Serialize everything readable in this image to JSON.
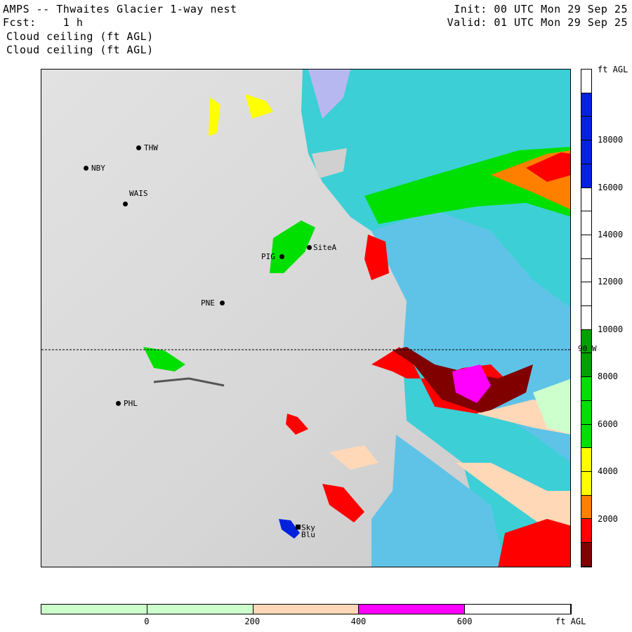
{
  "header": {
    "title": "AMPS -- Thwaites Glacier 1-way nest",
    "forecast": "Fcst:    1 h",
    "field_1": "Cloud ceiling (ft AGL)",
    "field_2": "Cloud ceiling (ft AGL)",
    "init": "Init: 00 UTC Mon 29 Sep 25",
    "valid": "Valid: 01 UTC Mon 29 Sep 25"
  },
  "map": {
    "meridian_label": "90 W",
    "stations": [
      {
        "name": "THW"
      },
      {
        "name": "NBY"
      },
      {
        "name": "WAIS"
      },
      {
        "name": "PIG"
      },
      {
        "name": "SiteA"
      },
      {
        "name": "PNE"
      },
      {
        "name": "PHL"
      },
      {
        "name": "Sky"
      },
      {
        "name": "Blu"
      }
    ]
  },
  "colorbar": {
    "units": "ft AGL",
    "labels": [
      "18000",
      "16000",
      "14000",
      "12000",
      "10000",
      "8000",
      "6000",
      "4000",
      "2000"
    ],
    "colors": [
      "#ffffff",
      "#0022dd",
      "#0022dd",
      "#0022dd",
      "#0022dd",
      "#ffffff",
      "#ffffff",
      "#ffffff",
      "#ffffff",
      "#ffffff",
      "#ffffff",
      "#00a000",
      "#00a000",
      "#00e000",
      "#00e000",
      "#00e000",
      "#ffff00",
      "#ffff00",
      "#ff8000",
      "#ff0000",
      "#800000"
    ]
  },
  "low_bar": {
    "units": "ft AGL",
    "labels": [
      "0",
      "200",
      "400",
      "600"
    ],
    "colors": [
      "#ccffcc",
      "#ccffcc",
      "#ffd8b8",
      "#ff00ff",
      "#ffffff"
    ]
  }
}
